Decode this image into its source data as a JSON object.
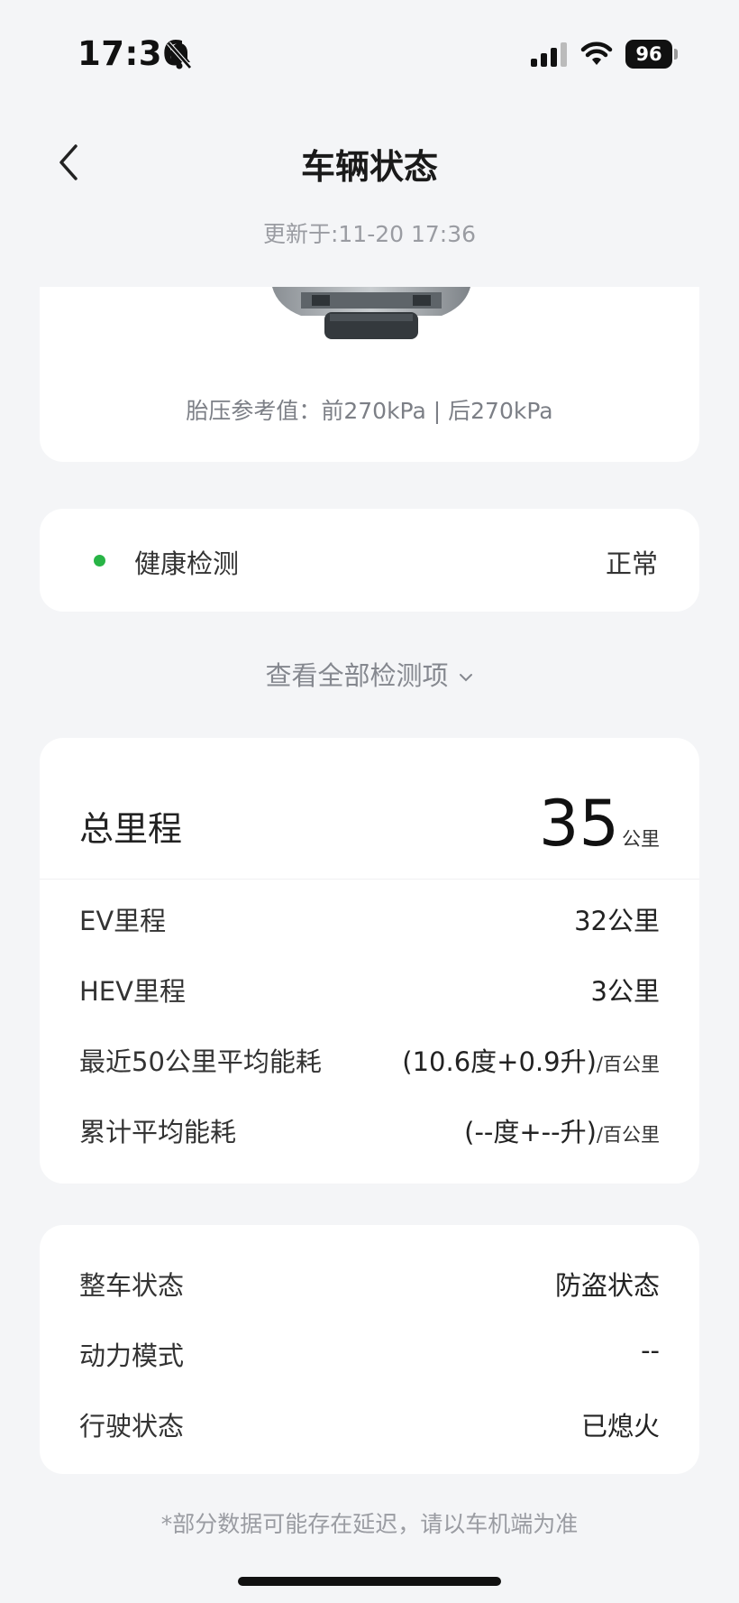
{
  "status_bar": {
    "time": "17:36",
    "battery": "96"
  },
  "header": {
    "title": "车辆状态",
    "updated": "更新于:11-20 17:36"
  },
  "tire": {
    "pressure_text": "胎压参考值：前270kPa | 后270kPa"
  },
  "health": {
    "label": "健康检测",
    "value": "正常",
    "dot_color": "#28b446"
  },
  "view_all": {
    "label": "查看全部检测项"
  },
  "mileage": {
    "total_label": "总里程",
    "total_value": "35",
    "total_unit": "公里",
    "rows": [
      {
        "label": "EV里程",
        "value": "32公里",
        "unit": ""
      },
      {
        "label": "HEV里程",
        "value": "3公里",
        "unit": ""
      },
      {
        "label": "最近50公里平均能耗",
        "value": "(10.6度+0.9升)",
        "unit": "/百公里"
      },
      {
        "label": "累计平均能耗",
        "value": "(--度+--升)",
        "unit": "/百公里"
      }
    ]
  },
  "vehicle_status": {
    "rows": [
      {
        "label": "整车状态",
        "value": "防盗状态"
      },
      {
        "label": "动力模式",
        "value": "--"
      },
      {
        "label": "行驶状态",
        "value": "已熄火"
      }
    ]
  },
  "footer": {
    "note": "*部分数据可能存在延迟，请以车机端为准"
  }
}
